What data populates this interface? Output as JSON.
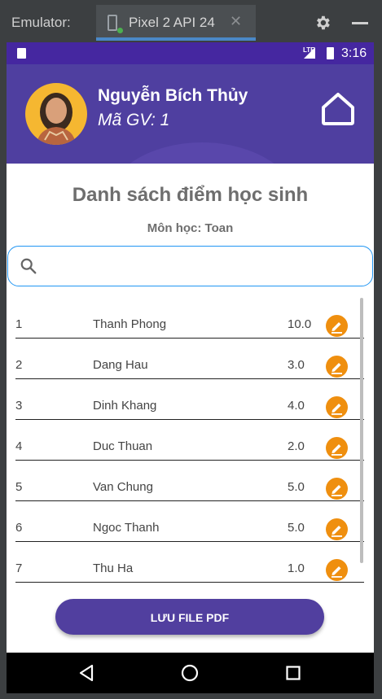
{
  "emulator": {
    "label": "Emulator:",
    "tab_title": "Pixel 2 API 24",
    "close_glyph": "✕",
    "icons": [
      "device-icon",
      "gear-icon",
      "minimize-icon"
    ]
  },
  "status_bar": {
    "network": "LTE",
    "time": "3:16",
    "color": "#4527a0"
  },
  "header": {
    "name": "Nguyễn Bích Thủy",
    "teacher_id": "Mã GV: 1",
    "color": "#4f3fa0",
    "icons": [
      "avatar",
      "home-icon"
    ]
  },
  "page": {
    "title": "Danh sách điểm học sinh",
    "subject": "Môn học: Toan"
  },
  "search": {
    "value": "",
    "icon": "search-icon"
  },
  "students": [
    {
      "no": "1",
      "name": "Thanh Phong",
      "score": "10.0"
    },
    {
      "no": "2",
      "name": "Dang Hau",
      "score": "3.0"
    },
    {
      "no": "3",
      "name": "Dinh Khang",
      "score": "4.0"
    },
    {
      "no": "4",
      "name": "Duc Thuan",
      "score": "2.0"
    },
    {
      "no": "5",
      "name": "Van Chung",
      "score": "5.0"
    },
    {
      "no": "6",
      "name": "Ngoc Thanh",
      "score": "5.0"
    },
    {
      "no": "7",
      "name": "Thu Ha",
      "score": "1.0"
    }
  ],
  "edit_icon": "pencil-icon",
  "edit_color": "#ef8f0f",
  "save_button": {
    "label": "LƯU FILE PDF",
    "color": "#513f9f"
  },
  "nav": {
    "icons": [
      "back-icon",
      "home-circle-icon",
      "recents-icon"
    ]
  }
}
